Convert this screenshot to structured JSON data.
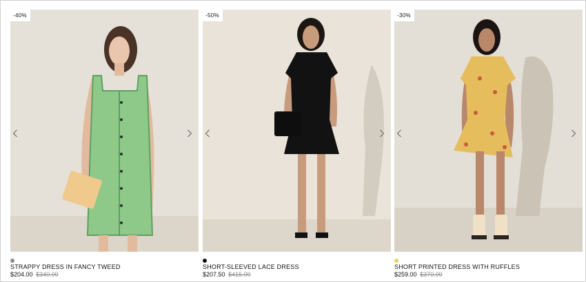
{
  "products": [
    {
      "badge": "-40%",
      "name": "STRAPPY DRESS IN FANCY TWEED",
      "price": "$204.00",
      "old_price": "$340.00",
      "swatch_color": "#8b8b7e",
      "background_color": "#e6e1d8",
      "dress_color": "#8fc98a"
    },
    {
      "badge": "-50%",
      "name": "SHORT-SLEEVED LACE DRESS",
      "price": "$207.50",
      "old_price": "$415.00",
      "swatch_color": "#111111",
      "background_color": "#e9e3d9",
      "dress_color": "#121212"
    },
    {
      "badge": "-30%",
      "name": "SHORT PRINTED DRESS WITH RUFFLES",
      "price": "$259.00",
      "old_price": "$370.00",
      "swatch_color": "#e9d35a",
      "background_color": "#e4dfd6",
      "dress_color": "#e6bd5c"
    }
  ],
  "icons": {
    "prev": "chevron-left-icon",
    "next": "chevron-right-icon"
  }
}
